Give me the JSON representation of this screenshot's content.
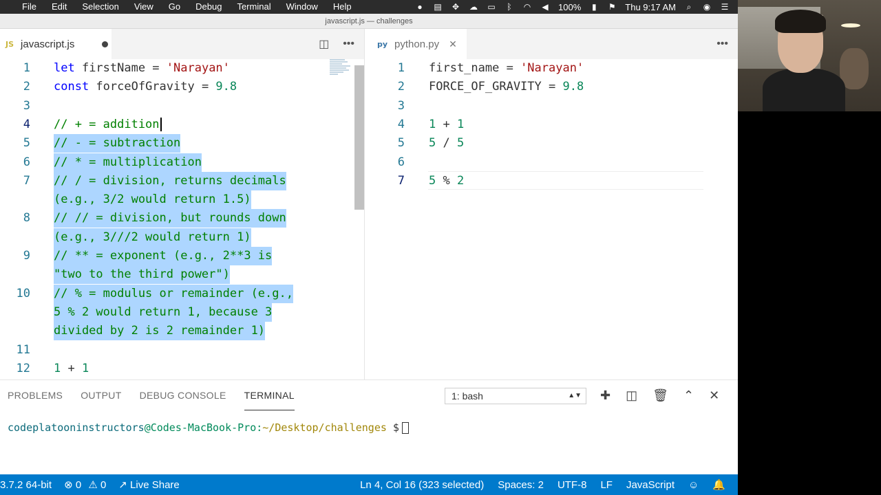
{
  "menubar": {
    "apple": "",
    "items": [
      "File",
      "Edit",
      "Selection",
      "View",
      "Go",
      "Debug",
      "Terminal",
      "Window",
      "Help"
    ],
    "battery": "100%",
    "time": "Thu 9:17 AM"
  },
  "window": {
    "title": "javascript.js — challenges"
  },
  "left_editor": {
    "tab": {
      "icon": "JS",
      "label": "javascript.js"
    },
    "lines": [
      {
        "n": "1",
        "parts": [
          [
            "k",
            "let"
          ],
          [
            "p",
            " firstName = "
          ],
          [
            "s",
            "'Narayan'"
          ]
        ]
      },
      {
        "n": "2",
        "parts": [
          [
            "k",
            "const"
          ],
          [
            "p",
            " forceOfGravity = "
          ],
          [
            "n",
            "9.8"
          ]
        ]
      },
      {
        "n": "3",
        "parts": []
      },
      {
        "n": "4",
        "parts": [
          [
            "c",
            "// + = addition"
          ]
        ]
      },
      {
        "n": "5",
        "parts": [
          [
            "c",
            "// - = subtraction"
          ]
        ]
      },
      {
        "n": "6",
        "parts": [
          [
            "c",
            "// * = multiplication"
          ]
        ]
      },
      {
        "n": "7",
        "parts": [
          [
            "c",
            "// / = division, returns decimals"
          ]
        ]
      },
      {
        "n": "",
        "parts": [
          [
            "c",
            "(e.g., 3/2 would return 1.5)"
          ]
        ]
      },
      {
        "n": "8",
        "parts": [
          [
            "c",
            "// // = division, but rounds down"
          ]
        ]
      },
      {
        "n": "",
        "parts": [
          [
            "c",
            "(e.g., 3///2 would return 1)"
          ]
        ]
      },
      {
        "n": "9",
        "parts": [
          [
            "c",
            "// ** = exponent (e.g., 2**3 is"
          ]
        ]
      },
      {
        "n": "",
        "parts": [
          [
            "c",
            "\"two to the third power\")"
          ]
        ]
      },
      {
        "n": "10",
        "parts": [
          [
            "c",
            "// % = modulus or remainder (e.g.,"
          ]
        ]
      },
      {
        "n": "",
        "parts": [
          [
            "c",
            "5 % 2 would return 1, because 3"
          ]
        ]
      },
      {
        "n": "",
        "parts": [
          [
            "c",
            "divided by 2 is 2 remainder 1)"
          ]
        ]
      },
      {
        "n": "11",
        "parts": []
      },
      {
        "n": "12",
        "parts": [
          [
            "n",
            "1"
          ],
          [
            "p",
            " + "
          ],
          [
            "n",
            "1"
          ]
        ]
      }
    ]
  },
  "right_editor": {
    "tab": {
      "icon": "py",
      "label": "python.py"
    },
    "lines": [
      {
        "n": "1",
        "parts": [
          [
            "p",
            "first_name = "
          ],
          [
            "s",
            "'Narayan'"
          ]
        ]
      },
      {
        "n": "2",
        "parts": [
          [
            "p",
            "FORCE_OF_GRAVITY = "
          ],
          [
            "n",
            "9.8"
          ]
        ]
      },
      {
        "n": "3",
        "parts": []
      },
      {
        "n": "4",
        "parts": [
          [
            "n",
            "1"
          ],
          [
            "p",
            " + "
          ],
          [
            "n",
            "1"
          ]
        ]
      },
      {
        "n": "5",
        "parts": [
          [
            "n",
            "5"
          ],
          [
            "p",
            " / "
          ],
          [
            "n",
            "5"
          ]
        ]
      },
      {
        "n": "6",
        "parts": []
      },
      {
        "n": "7",
        "parts": [
          [
            "n",
            "5"
          ],
          [
            "p",
            " % "
          ],
          [
            "n",
            "2"
          ]
        ]
      }
    ]
  },
  "panel": {
    "tabs": [
      "PROBLEMS",
      "OUTPUT",
      "DEBUG CONSOLE",
      "TERMINAL"
    ],
    "terminal_select": "1: bash",
    "prompt": {
      "user": "codeplatooninstructors",
      "host": "@Codes-MacBook-Pro:",
      "path": "~/Desktop/challenges",
      "symbol": " $"
    }
  },
  "statusbar": {
    "python": "3.7.2 64-bit",
    "errors": "0",
    "warnings": "0",
    "live_share": "Live Share",
    "position": "Ln 4, Col 16 (323 selected)",
    "spaces": "Spaces: 2",
    "encoding": "UTF-8",
    "eol": "LF",
    "language": "JavaScript"
  },
  "colors": {
    "statusbar": "#007acc",
    "selection": "#add6ff",
    "comment": "#008000",
    "string": "#a31515",
    "number": "#098658",
    "keyword": "#0000ff"
  }
}
